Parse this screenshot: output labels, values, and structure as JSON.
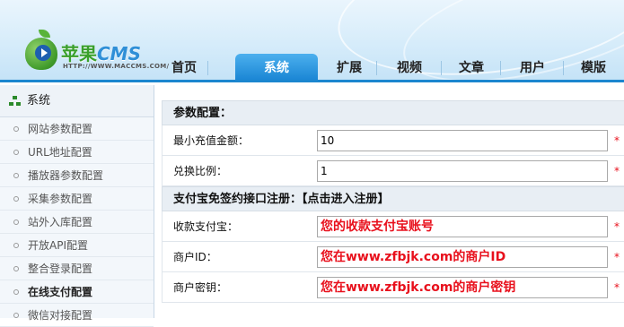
{
  "app": {
    "logo_text": "苹果",
    "logo_cms": "CMS",
    "logo_url": "HTTP://WWW.MACCMS.COM/"
  },
  "nav": {
    "tabs": [
      {
        "label": "首页"
      },
      {
        "label": "系统",
        "active": true
      },
      {
        "label": "扩展"
      },
      {
        "label": "视频"
      },
      {
        "label": "文章"
      },
      {
        "label": "用户"
      },
      {
        "label": "模版"
      }
    ]
  },
  "sidebar": {
    "title": "系统",
    "items": [
      {
        "label": "网站参数配置"
      },
      {
        "label": "URL地址配置"
      },
      {
        "label": "播放器参数配置"
      },
      {
        "label": "采集参数配置"
      },
      {
        "label": "站外入库配置"
      },
      {
        "label": "开放API配置"
      },
      {
        "label": "整合登录配置"
      },
      {
        "label": "在线支付配置",
        "active": true
      },
      {
        "label": "微信对接配置"
      }
    ]
  },
  "main": {
    "section1_title": "参数配置：",
    "min_recharge": {
      "label": "最小充值金额：",
      "value": "10",
      "required": "*"
    },
    "exchange_ratio": {
      "label": "兑换比例：",
      "value": "1",
      "required": "*"
    },
    "section2_title": "支付宝免签约接口注册：【点击进入注册】",
    "alipay_account": {
      "label": "收款支付宝：",
      "value": "您的收款支付宝账号",
      "required": "*"
    },
    "merchant_id": {
      "label": "商户ID：",
      "value": "您在www.zfbjk.com的商户ID",
      "required": "*"
    },
    "merchant_key": {
      "label": "商户密钥：",
      "value": "您在www.zfbjk.com的商户密钥",
      "required": "*"
    }
  },
  "colors": {
    "accent": "#1b86cf",
    "required": "#e8101c",
    "logo_green": "#3aa02c"
  }
}
